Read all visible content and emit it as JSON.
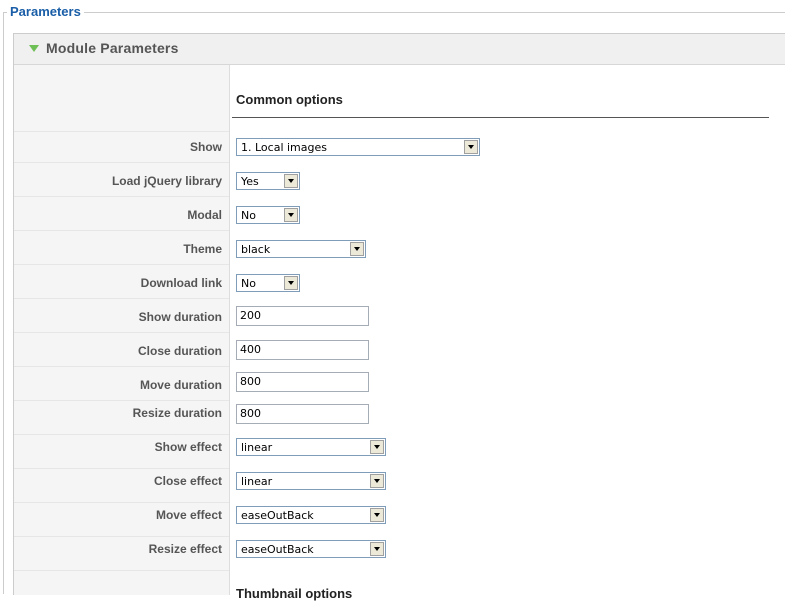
{
  "fieldset": {
    "legend": "Parameters"
  },
  "panel": {
    "title": "Module Parameters",
    "section_title": "Common options",
    "next_section_title": "Thumbnail options"
  },
  "fields": [
    {
      "label": "Show",
      "type": "select",
      "value": "1. Local images"
    },
    {
      "label": "Load jQuery library",
      "type": "select",
      "value": "Yes"
    },
    {
      "label": "Modal",
      "type": "select",
      "value": "No"
    },
    {
      "label": "Theme",
      "type": "select",
      "value": "black"
    },
    {
      "label": "Download link",
      "type": "select",
      "value": "No"
    },
    {
      "label": "Show duration",
      "type": "text",
      "value": "200"
    },
    {
      "label": "Close duration",
      "type": "text",
      "value": "400"
    },
    {
      "label": "Move duration",
      "type": "text",
      "value": "800"
    },
    {
      "label": "Resize duration",
      "type": "text",
      "value": "800"
    },
    {
      "label": "Show effect",
      "type": "select",
      "value": "linear"
    },
    {
      "label": "Close effect",
      "type": "select",
      "value": "linear"
    },
    {
      "label": "Move effect",
      "type": "select",
      "value": "easeOutBack"
    },
    {
      "label": "Resize effect",
      "type": "select",
      "value": "easeOutBack"
    }
  ],
  "colors": {
    "legend": "#1a5ea8",
    "toggle_icon": "#6fbf57",
    "header_bg": "#f0f0f0",
    "label_col_bg": "#f5f5f5"
  },
  "icons": {
    "toggle": "triangle-down-icon",
    "dropdown": "chevron-down-icon"
  }
}
